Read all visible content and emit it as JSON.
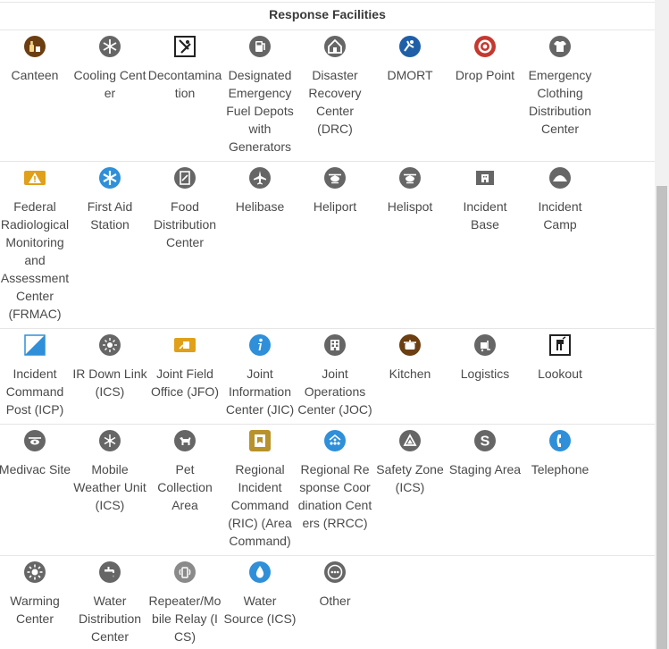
{
  "section": {
    "title": "Response Facilities"
  },
  "rows": [
    [
      {
        "label": "Canteen",
        "icon": "canteen-icon"
      },
      {
        "label": "Cooling Center",
        "icon": "snowflake-icon"
      },
      {
        "label": "Decontamination",
        "icon": "decontamination-icon"
      },
      {
        "label": "Designated Emergency Fuel Depots with Generators",
        "icon": "fuel-icon"
      },
      {
        "label": "Disaster Recovery Center (DRC)",
        "icon": "house-icon"
      },
      {
        "label": "DMORT",
        "icon": "dmort-icon"
      },
      {
        "label": "Drop Point",
        "icon": "target-icon"
      },
      {
        "label": "Emergency Clothing Distribution Center",
        "icon": "shirt-icon"
      }
    ],
    [
      {
        "label": "Federal Radiological Monitoring and Assessment Center (FRMAC)",
        "icon": "warning-icon"
      },
      {
        "label": "First Aid Station",
        "icon": "first-aid-icon"
      },
      {
        "label": "Food Distribution Center",
        "icon": "food-icon"
      },
      {
        "label": "Helibase",
        "icon": "airplane-icon"
      },
      {
        "label": "Heliport",
        "icon": "helicopter-icon"
      },
      {
        "label": "Helispot",
        "icon": "helicopter-icon"
      },
      {
        "label": "Incident Base",
        "icon": "building-icon"
      },
      {
        "label": "Incident Camp",
        "icon": "tent-icon"
      }
    ],
    [
      {
        "label": "Incident Command Post (ICP)",
        "icon": "command-post-icon"
      },
      {
        "label": "IR Down Link (ICS)",
        "icon": "sun-icon"
      },
      {
        "label": "Joint Field Office (JFO)",
        "icon": "office-icon"
      },
      {
        "label": "Joint Information Center (JIC)",
        "icon": "info-icon"
      },
      {
        "label": "Joint Operations Center (JOC)",
        "icon": "grid-icon"
      },
      {
        "label": "Kitchen",
        "icon": "pot-icon"
      },
      {
        "label": "Logistics",
        "icon": "logistics-icon"
      },
      {
        "label": "Lookout",
        "icon": "lookout-icon"
      }
    ],
    [
      {
        "label": "Medivac Site",
        "icon": "medivac-icon"
      },
      {
        "label": "Mobile Weather Unit (ICS)",
        "icon": "weather-icon"
      },
      {
        "label": "Pet Collection Area",
        "icon": "pet-icon"
      },
      {
        "label": "Regional Incident Command (RIC) (Area Command)",
        "icon": "regional-command-icon"
      },
      {
        "label": "Regional Response Coordination Centers (RRCC)",
        "icon": "coordination-icon"
      },
      {
        "label": "Safety Zone (ICS)",
        "icon": "safety-zone-icon"
      },
      {
        "label": "Staging Area",
        "icon": "staging-icon"
      },
      {
        "label": "Telephone",
        "icon": "telephone-icon"
      }
    ],
    [
      {
        "label": "Warming Center",
        "icon": "warming-icon"
      },
      {
        "label": "Water Distribution Center",
        "icon": "faucet-icon"
      },
      {
        "label": "Repeater/Mobile Relay (ICS)",
        "icon": "repeater-icon"
      },
      {
        "label": "Water Source (ICS)",
        "icon": "water-drop-icon"
      },
      {
        "label": "Other",
        "icon": "other-icon"
      }
    ]
  ],
  "colors": {
    "gray": "#666666",
    "brown": "#6b3f12",
    "blue": "#1f5fa8",
    "red": "#c4392f",
    "gold": "#e0a01a",
    "skyblue": "#2f8fd8"
  }
}
